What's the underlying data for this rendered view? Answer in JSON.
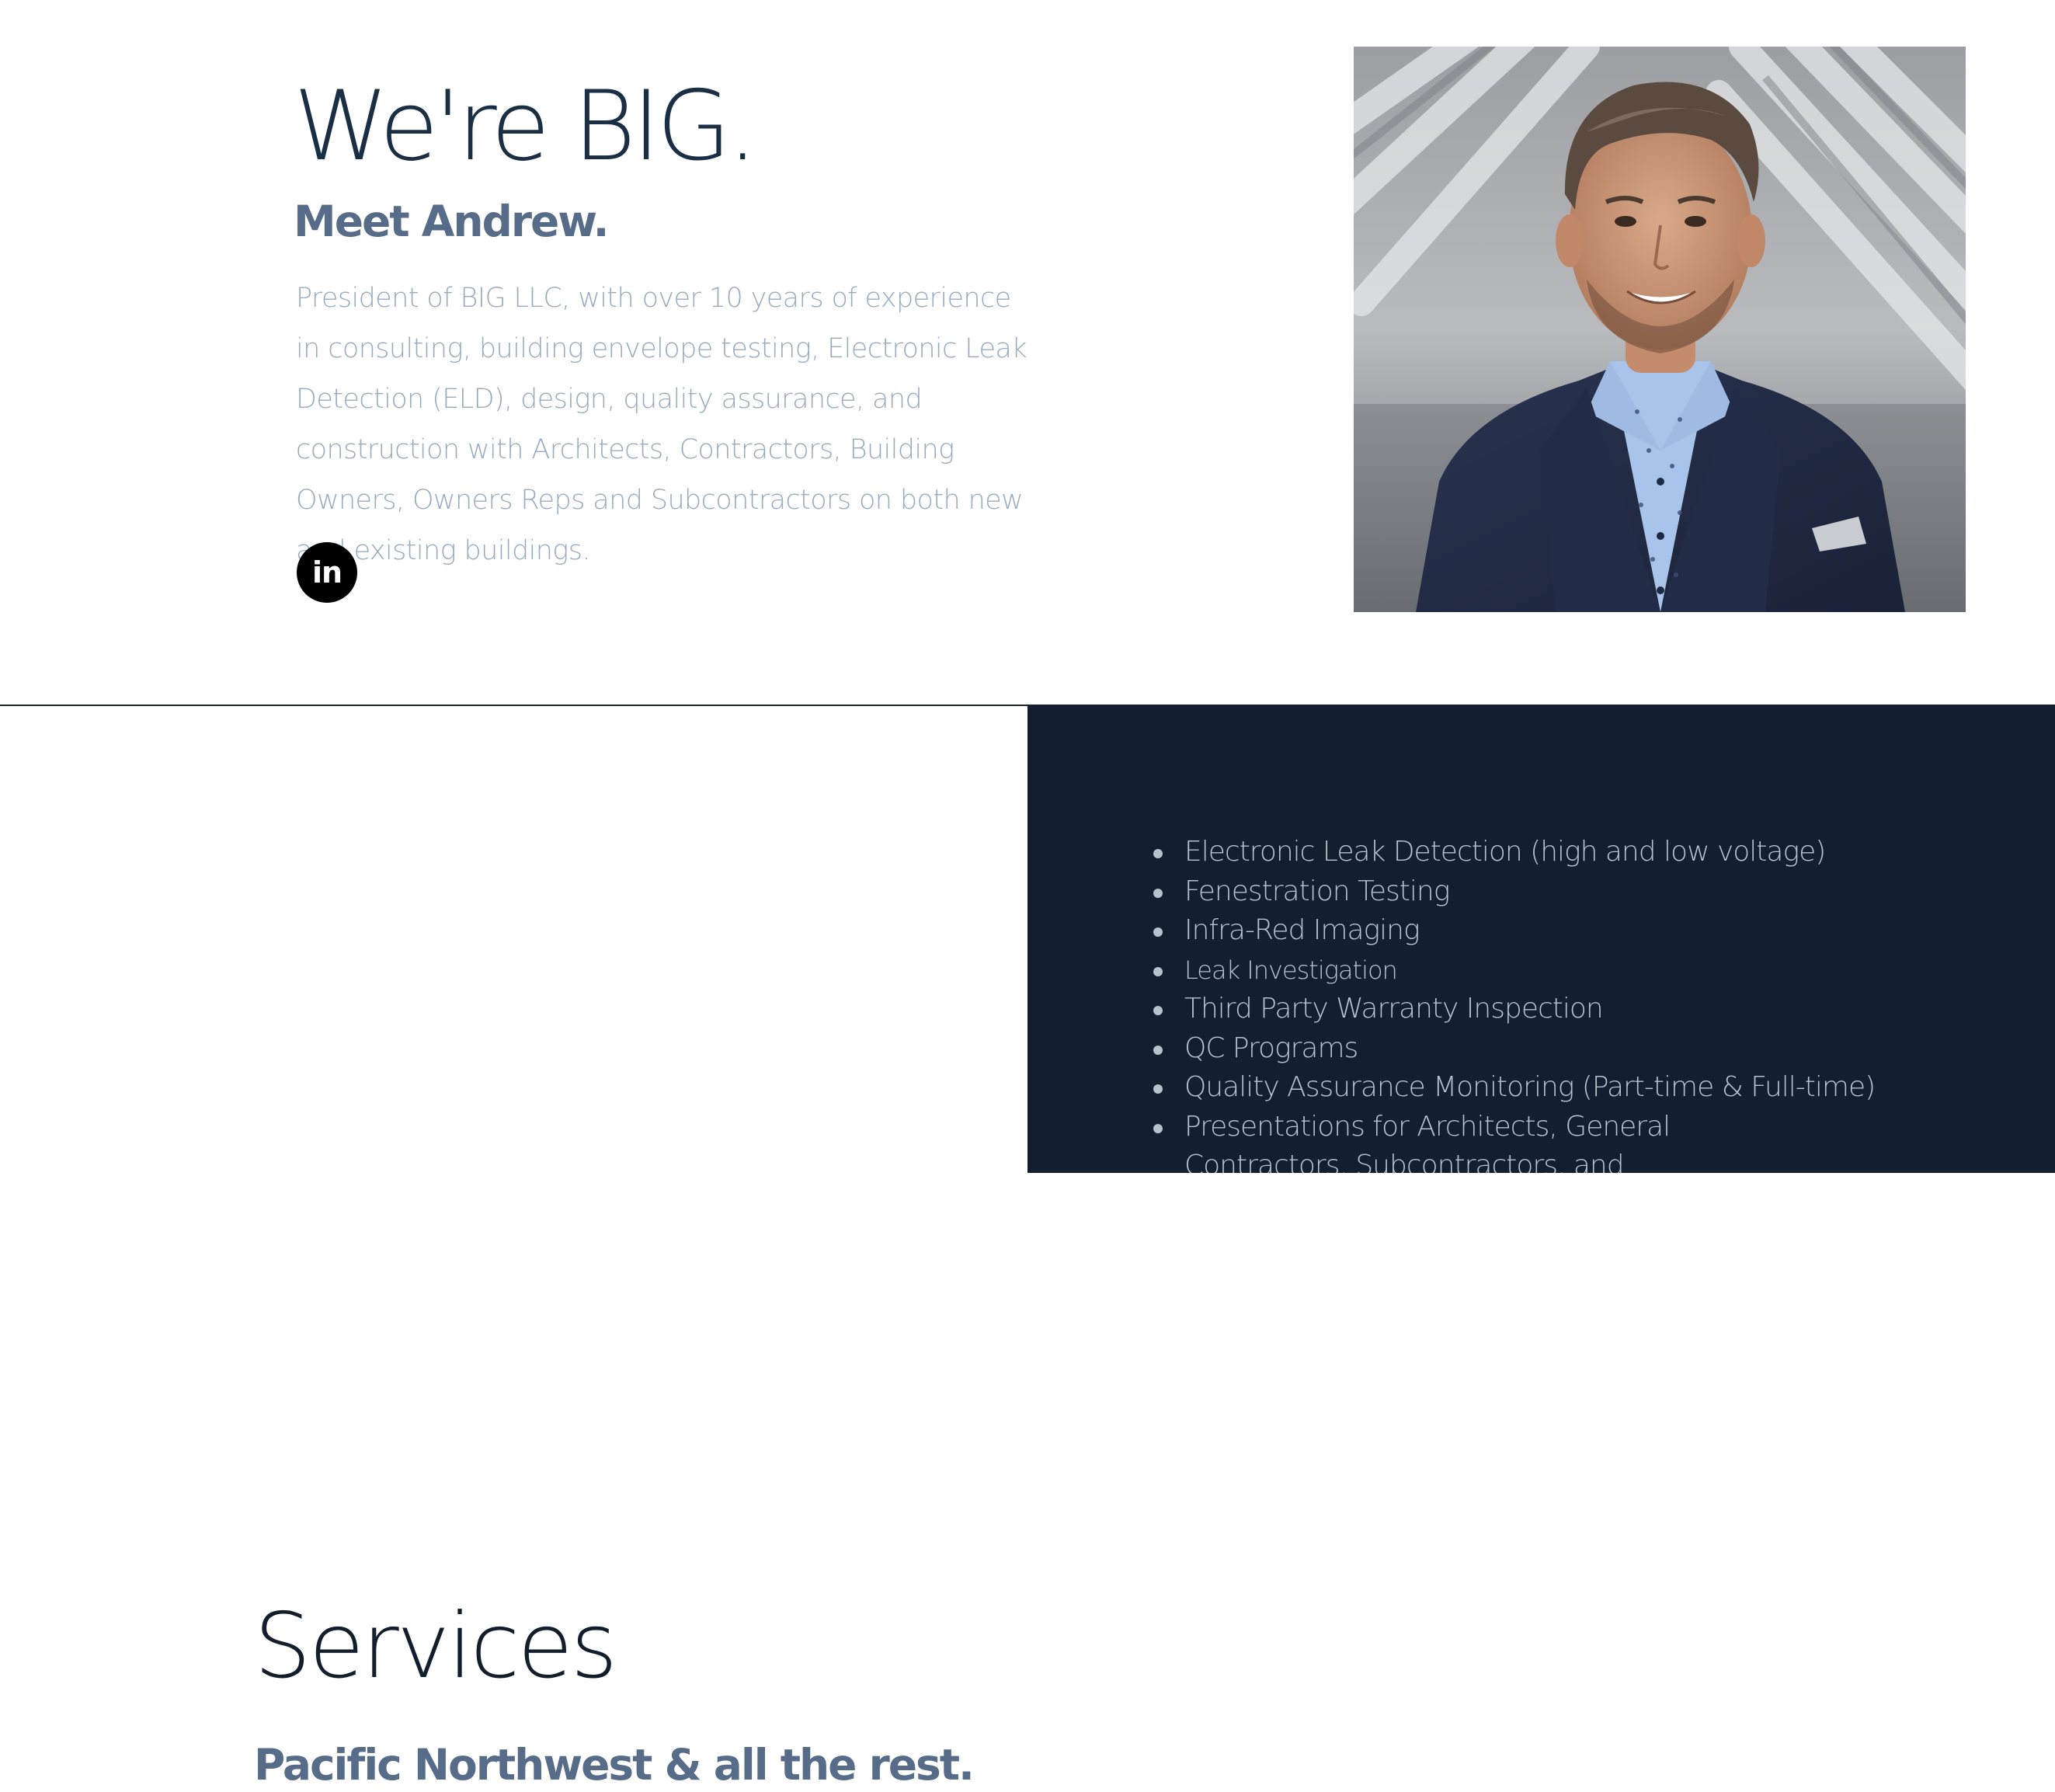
{
  "about": {
    "headline": "We're BIG.",
    "subheadline": "Meet Andrew.",
    "bio": "President of BIG LLC, with over 10 years of experience in consulting, building envelope testing, Electronic Leak Detection (ELD), design, quality assurance, and construction with Architects, Contractors, Building Owners, Owners Reps and Subcontractors on both new and existing buildings.",
    "linkedin_icon_text": "in"
  },
  "services": {
    "title": "Services",
    "subtitle": "Pacific Northwest & all the rest.",
    "items": [
      "Electronic Leak Detection (high and low voltage)",
      "Fenestration Testing",
      "Infra-Red Imaging",
      "Leak Investigation",
      "Third Party Warranty Inspection",
      "QC Programs",
      "Quality Assurance Monitoring (Part-time & Full-time)",
      "Presentations for Architects, General Contractors, Subcontractors, and Manufacturers"
    ]
  },
  "colors": {
    "dark_navy": "#131f2e",
    "heading": "#1a2e44",
    "subheading": "#566c88",
    "body_text": "#9aabc0"
  },
  "icons": {
    "linkedin": "linkedin-icon"
  }
}
